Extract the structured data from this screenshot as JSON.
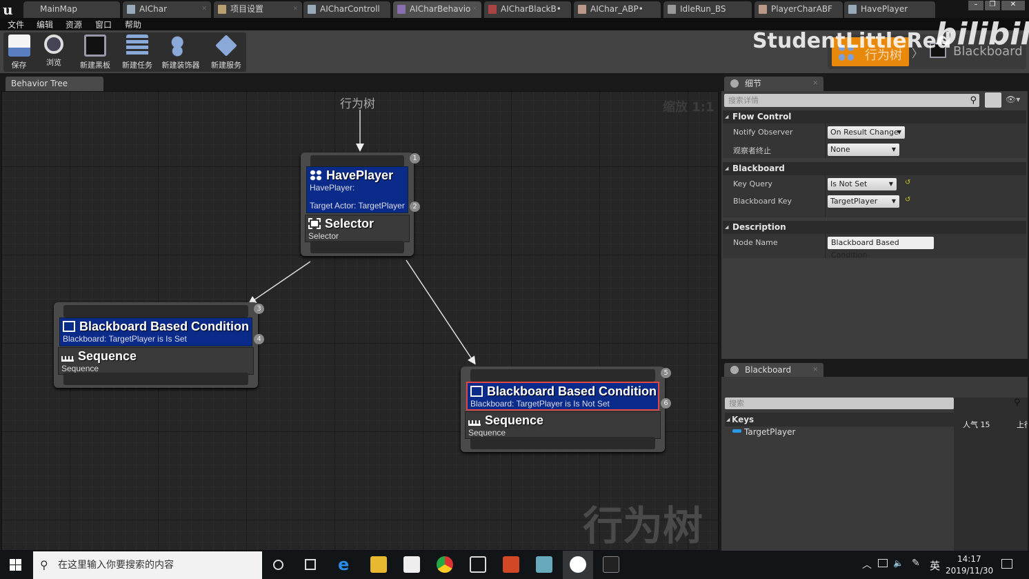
{
  "doc_tabs": [
    {
      "label": "MainMap"
    },
    {
      "label": "AIChar"
    },
    {
      "label": "项目设置"
    },
    {
      "label": "AICharControll"
    },
    {
      "label": "AICharBehavio"
    },
    {
      "label": "AICharBlackB•"
    },
    {
      "label": "AIChar_ABP•"
    },
    {
      "label": "IdleRun_BS"
    },
    {
      "label": "PlayerCharABF"
    },
    {
      "label": "HavePlayer"
    }
  ],
  "menu": [
    "文件",
    "编辑",
    "资源",
    "窗口",
    "帮助"
  ],
  "toolbar": [
    {
      "label": "保存",
      "icon": "save-icon"
    },
    {
      "label": "浏览",
      "icon": "browse-icon"
    },
    {
      "label": "新建黑板",
      "icon": "new-blackboard-icon"
    },
    {
      "label": "新建任务",
      "icon": "new-task-icon"
    },
    {
      "label": "新建装饰器",
      "icon": "new-decorator-icon"
    },
    {
      "label": "新建服务",
      "icon": "new-service-icon"
    }
  ],
  "mode_switch": {
    "behavior_tree": "行为树",
    "blackboard": "Blackboard",
    "active_color": "#e8890c"
  },
  "watermark": {
    "channel": "StudentLittleRed",
    "logo": "bilibili"
  },
  "graph": {
    "tab": "Behavior Tree",
    "title": "行为树",
    "zoom": "缩放 1:1",
    "big_label": "行为树",
    "nodes": [
      {
        "decorator": "HavePlayer",
        "dec_sub1": "HavePlayer:",
        "dec_sub2": "Target Actor: TargetPlayer",
        "composite": "Selector",
        "comp_sub": "Selector",
        "badges": [
          "1",
          "2"
        ]
      },
      {
        "decorator": "Blackboard Based Condition",
        "dec_sub": "Blackboard: TargetPlayer is Is Set",
        "composite": "Sequence",
        "comp_sub": "Sequence",
        "badges": [
          "3",
          "4"
        ]
      },
      {
        "decorator": "Blackboard Based Condition",
        "dec_sub": "Blackboard: TargetPlayer is Is Not Set",
        "composite": "Sequence",
        "comp_sub": "Sequence",
        "badges": [
          "5",
          "6"
        ],
        "selected": true
      }
    ]
  },
  "details": {
    "tab": "细节",
    "search_placeholder": "搜索详情",
    "flow_control": {
      "title": "Flow Control",
      "notify_label": "Notify Observer",
      "notify_value": "On Result Change",
      "abort_label": "观察者终止",
      "abort_value": "None"
    },
    "blackboard": {
      "title": "Blackboard",
      "key_query_label": "Key Query",
      "key_query_value": "Is Not Set",
      "bb_key_label": "Blackboard Key",
      "bb_key_value": "TargetPlayer"
    },
    "description": {
      "title": "Description",
      "node_name_label": "Node Name",
      "node_name_value": "Blackboard Based Condition"
    }
  },
  "blackboard_panel": {
    "tab": "Blackboard",
    "search_placeholder": "搜索",
    "keys_title": "Keys",
    "keys": [
      "TargetPlayer"
    ],
    "overlay_popularity": "人气 15",
    "overlay_cut": "上行"
  },
  "taskbar": {
    "search_placeholder": "在这里输入你要搜索的内容",
    "ime": "英",
    "time": "14:17",
    "date": "2019/11/30"
  }
}
